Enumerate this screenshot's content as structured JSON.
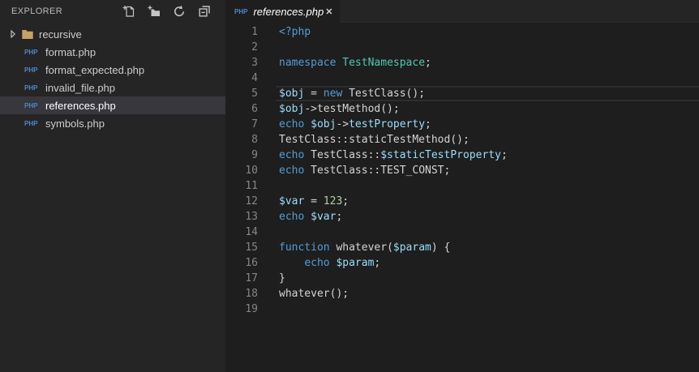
{
  "colors": {
    "editor_bg": "#1e1e1e",
    "sidebar_bg": "#252526",
    "selection_bg": "#37373d",
    "keyword": "#569cd6",
    "class_name": "#4ec9b0",
    "variable": "#9cdcfe",
    "number": "#b5cea8",
    "default_text": "#d4d4d4",
    "line_number": "#858585",
    "php_badge": "#4f87c5",
    "folder_icon": "#c5a166"
  },
  "sidebar": {
    "title": "EXPLORER",
    "file_badge": "PHP",
    "actions": [
      {
        "name": "new-file-icon",
        "label": "New File"
      },
      {
        "name": "new-folder-icon",
        "label": "New Folder"
      },
      {
        "name": "refresh-icon",
        "label": "Refresh"
      },
      {
        "name": "collapse-all-icon",
        "label": "Collapse All"
      }
    ],
    "items": [
      {
        "type": "folder",
        "label": "recursive",
        "selected": false
      },
      {
        "type": "php-file",
        "label": "format.php",
        "selected": false
      },
      {
        "type": "php-file",
        "label": "format_expected.php",
        "selected": false
      },
      {
        "type": "php-file",
        "label": "invalid_file.php",
        "selected": false
      },
      {
        "type": "php-file",
        "label": "references.php",
        "selected": true
      },
      {
        "type": "php-file",
        "label": "symbols.php",
        "selected": false
      }
    ]
  },
  "tabbar": {
    "tabs": [
      {
        "label": "references.php",
        "badge": "PHP",
        "close": "✕",
        "active": true,
        "preview": true
      }
    ]
  },
  "editor": {
    "language": "php",
    "current_line": 5,
    "lines": [
      {
        "num": "1",
        "tokens": [
          [
            "kw",
            "<?php"
          ]
        ]
      },
      {
        "num": "2",
        "tokens": []
      },
      {
        "num": "3",
        "tokens": [
          [
            "kw",
            "namespace"
          ],
          [
            "def",
            " "
          ],
          [
            "cls",
            "TestNamespace"
          ],
          [
            "def",
            ";"
          ]
        ]
      },
      {
        "num": "4",
        "tokens": []
      },
      {
        "num": "5",
        "tokens": [
          [
            "var",
            "$obj"
          ],
          [
            "def",
            " = "
          ],
          [
            "kw",
            "new"
          ],
          [
            "def",
            " TestClass();"
          ]
        ]
      },
      {
        "num": "6",
        "tokens": [
          [
            "var",
            "$obj"
          ],
          [
            "def",
            "->testMethod();"
          ]
        ]
      },
      {
        "num": "7",
        "tokens": [
          [
            "kw",
            "echo"
          ],
          [
            "def",
            " "
          ],
          [
            "var",
            "$obj"
          ],
          [
            "def",
            "->"
          ],
          [
            "var",
            "testProperty"
          ],
          [
            "def",
            ";"
          ]
        ]
      },
      {
        "num": "8",
        "tokens": [
          [
            "def",
            "TestClass::staticTestMethod();"
          ]
        ]
      },
      {
        "num": "9",
        "tokens": [
          [
            "kw",
            "echo"
          ],
          [
            "def",
            " TestClass::"
          ],
          [
            "var",
            "$staticTestProperty"
          ],
          [
            "def",
            ";"
          ]
        ]
      },
      {
        "num": "10",
        "tokens": [
          [
            "kw",
            "echo"
          ],
          [
            "def",
            " TestClass::TEST_CONST;"
          ]
        ]
      },
      {
        "num": "11",
        "tokens": []
      },
      {
        "num": "12",
        "tokens": [
          [
            "var",
            "$var"
          ],
          [
            "def",
            " = "
          ],
          [
            "num",
            "123"
          ],
          [
            "def",
            ";"
          ]
        ]
      },
      {
        "num": "13",
        "tokens": [
          [
            "kw",
            "echo"
          ],
          [
            "def",
            " "
          ],
          [
            "var",
            "$var"
          ],
          [
            "def",
            ";"
          ]
        ]
      },
      {
        "num": "14",
        "tokens": []
      },
      {
        "num": "15",
        "tokens": [
          [
            "kw",
            "function"
          ],
          [
            "def",
            " whatever("
          ],
          [
            "var",
            "$param"
          ],
          [
            "def",
            ") {"
          ]
        ]
      },
      {
        "num": "16",
        "tokens": [
          [
            "def",
            "    "
          ],
          [
            "kw",
            "echo"
          ],
          [
            "def",
            " "
          ],
          [
            "var",
            "$param"
          ],
          [
            "def",
            ";"
          ]
        ]
      },
      {
        "num": "17",
        "tokens": [
          [
            "def",
            "}"
          ]
        ]
      },
      {
        "num": "18",
        "tokens": [
          [
            "def",
            "whatever();"
          ]
        ]
      },
      {
        "num": "19",
        "tokens": []
      }
    ]
  }
}
